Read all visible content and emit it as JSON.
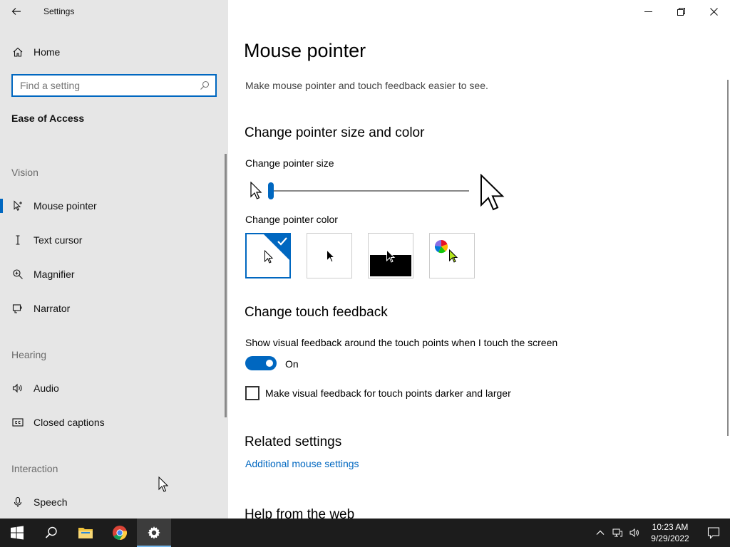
{
  "app": {
    "title": "Settings"
  },
  "nav": {
    "home_label": "Home",
    "search_placeholder": "Find a setting",
    "section_title": "Ease of Access",
    "groups": [
      {
        "title": "Vision"
      },
      {
        "title": "Hearing"
      },
      {
        "title": "Interaction"
      }
    ],
    "items": [
      {
        "label": "Mouse pointer",
        "icon": "mouse-pointer-icon",
        "selected": true
      },
      {
        "label": "Text cursor",
        "icon": "text-cursor-icon"
      },
      {
        "label": "Magnifier",
        "icon": "magnifier-icon"
      },
      {
        "label": "Narrator",
        "icon": "narrator-icon"
      },
      {
        "label": "Audio",
        "icon": "audio-icon"
      },
      {
        "label": "Closed captions",
        "icon": "closed-captions-icon"
      },
      {
        "label": "Speech",
        "icon": "microphone-icon"
      }
    ]
  },
  "main": {
    "title": "Mouse pointer",
    "description": "Make mouse pointer and touch feedback easier to see.",
    "size_color_heading": "Change pointer size and color",
    "pointer_size_label": "Change pointer size",
    "pointer_size_value": 1,
    "pointer_color_label": "Change pointer color",
    "color_options": [
      {
        "name": "white",
        "selected": true
      },
      {
        "name": "black",
        "selected": false
      },
      {
        "name": "inverted",
        "selected": false
      },
      {
        "name": "custom",
        "selected": false
      }
    ],
    "touch_heading": "Change touch feedback",
    "touch_desc": "Show visual feedback around the touch points when I touch the screen",
    "toggle_state": "On",
    "checkbox_label": "Make visual feedback for touch points darker and larger",
    "checkbox_checked": false,
    "related_heading": "Related settings",
    "related_link": "Additional mouse settings",
    "help_heading": "Help from the web"
  },
  "taskbar": {
    "time": "10:23 AM",
    "date": "9/29/2022",
    "pinned": [
      "start-button",
      "search-button",
      "file-explorer",
      "chrome",
      "settings"
    ]
  },
  "colors": {
    "accent": "#0067c0",
    "nav_bg": "#e6e6e6",
    "taskbar_bg": "#1c1c1c"
  }
}
